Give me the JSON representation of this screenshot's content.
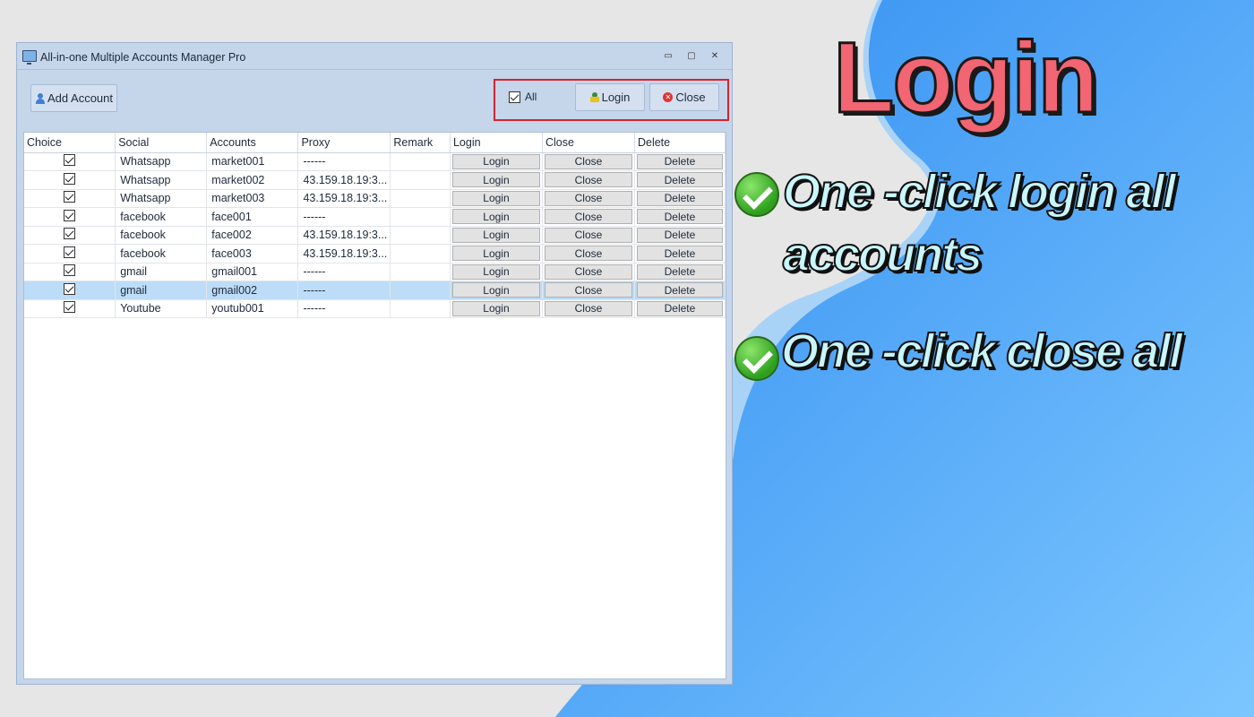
{
  "window": {
    "title": "All-in-one Multiple Accounts Manager Pro",
    "controls": {
      "minimize": "▭",
      "maximize": "▢",
      "close": "✕"
    }
  },
  "toolbar": {
    "add_account": "Add Account",
    "all_label": "All",
    "all_checked": true,
    "login": "Login",
    "close": "Close"
  },
  "grid": {
    "columns": [
      "Choice",
      "Social",
      "Accounts",
      "Proxy",
      "Remark",
      "Login",
      "Close",
      "Delete"
    ],
    "rows": [
      {
        "social": "Whatsapp",
        "account": "market001",
        "proxy": "------",
        "remark": "",
        "login": "Login",
        "close": "Close",
        "delete": "Delete"
      },
      {
        "social": "Whatsapp",
        "account": "market002",
        "proxy": "43.159.18.19:3...",
        "remark": "",
        "login": "Login",
        "close": "Close",
        "delete": "Delete"
      },
      {
        "social": "Whatsapp",
        "account": "market003",
        "proxy": "43.159.18.19:3...",
        "remark": "",
        "login": "Login",
        "close": "Close",
        "delete": "Delete"
      },
      {
        "social": "facebook",
        "account": "face001",
        "proxy": "------",
        "remark": "",
        "login": "Login",
        "close": "Close",
        "delete": "Delete"
      },
      {
        "social": "facebook",
        "account": "face002",
        "proxy": "43.159.18.19:3...",
        "remark": "",
        "login": "Login",
        "close": "Close",
        "delete": "Delete"
      },
      {
        "social": "facebook",
        "account": "face003",
        "proxy": "43.159.18.19:3...",
        "remark": "",
        "login": "Login",
        "close": "Close",
        "delete": "Delete"
      },
      {
        "social": "gmail",
        "account": "gmail001",
        "proxy": "------",
        "remark": "",
        "login": "Login",
        "close": "Close",
        "delete": "Delete"
      },
      {
        "social": "gmail",
        "account": "gmail002",
        "proxy": "------",
        "remark": "",
        "login": "Login",
        "close": "Close",
        "delete": "Delete"
      },
      {
        "social": "Youtube",
        "account": "youtub001",
        "proxy": "------",
        "remark": "",
        "login": "Login",
        "close": "Close",
        "delete": "Delete"
      }
    ],
    "selected_row": 7
  },
  "promo": {
    "headline": "Login",
    "feature1_line1": "One -click login all",
    "feature1_line2": "accounts",
    "feature2": "One -click close all"
  },
  "icons": {
    "app": "monitor-icon",
    "add": "user-icon",
    "login": "login-icon",
    "close": "close-icon",
    "feature": "green-check-icon"
  },
  "colors": {
    "accent_red": "#d6232f",
    "headline": "#f26572",
    "feature_text": "#c9f6fb",
    "blue_bg": "#4aa7f5",
    "selected_row": "#bcdcf8"
  }
}
